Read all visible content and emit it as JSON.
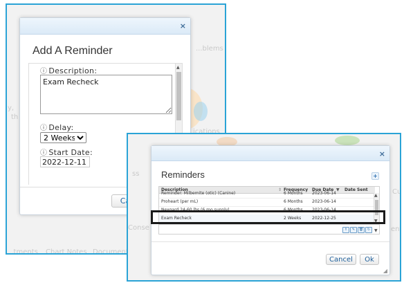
{
  "colors": {
    "panel_border": "#2aa3d6",
    "link_blue": "#1f5f9a"
  },
  "background_app": {
    "text_problems": "...blems",
    "text_ications": "ications",
    "text_tments": "...tments",
    "text_chart_notes": "Chart Notes",
    "text_document": "Document",
    "text_conse": "Conse",
    "text_ent": "ent",
    "text_cu": "Cu",
    "text_ss": "ss",
    "text_y": "y,",
    "text_th": "th",
    "text_ca": "Ca"
  },
  "add_reminder_dialog": {
    "close_icon": "×",
    "title": "Add A Reminder",
    "description_label": "Description:",
    "description_value": "Exam Recheck",
    "delay_label": "Delay:",
    "delay_selected": "2 Weeks",
    "start_date_label": "Start Date:",
    "start_date_value": "2022-12-11",
    "info_icon": "ⓘ",
    "cancel_partial": "Ca"
  },
  "reminders_dialog": {
    "close_icon": "×",
    "title": "Reminders",
    "add_icon": "+",
    "columns": [
      "Description",
      "Frequency",
      "Due Date",
      "Date Sent"
    ],
    "rows": [
      {
        "description": "Reminder: Milbemite (otic) (Canine)",
        "frequency": "6 Months",
        "due": "2023-06-14",
        "sent": ""
      },
      {
        "description": "Proheart (per mL)",
        "frequency": "6 Months",
        "due": "2023-06-14",
        "sent": ""
      },
      {
        "description": "Nexgard 24-60 lbs (6 mo supply)",
        "frequency": "6 Months",
        "due": "2023-06-14",
        "sent": ""
      },
      {
        "description": "Exam Recheck",
        "frequency": "2 Weeks",
        "due": "2022-12-25",
        "sent": ""
      }
    ],
    "cancel_label": "Cancel",
    "ok_label": "Ok"
  }
}
